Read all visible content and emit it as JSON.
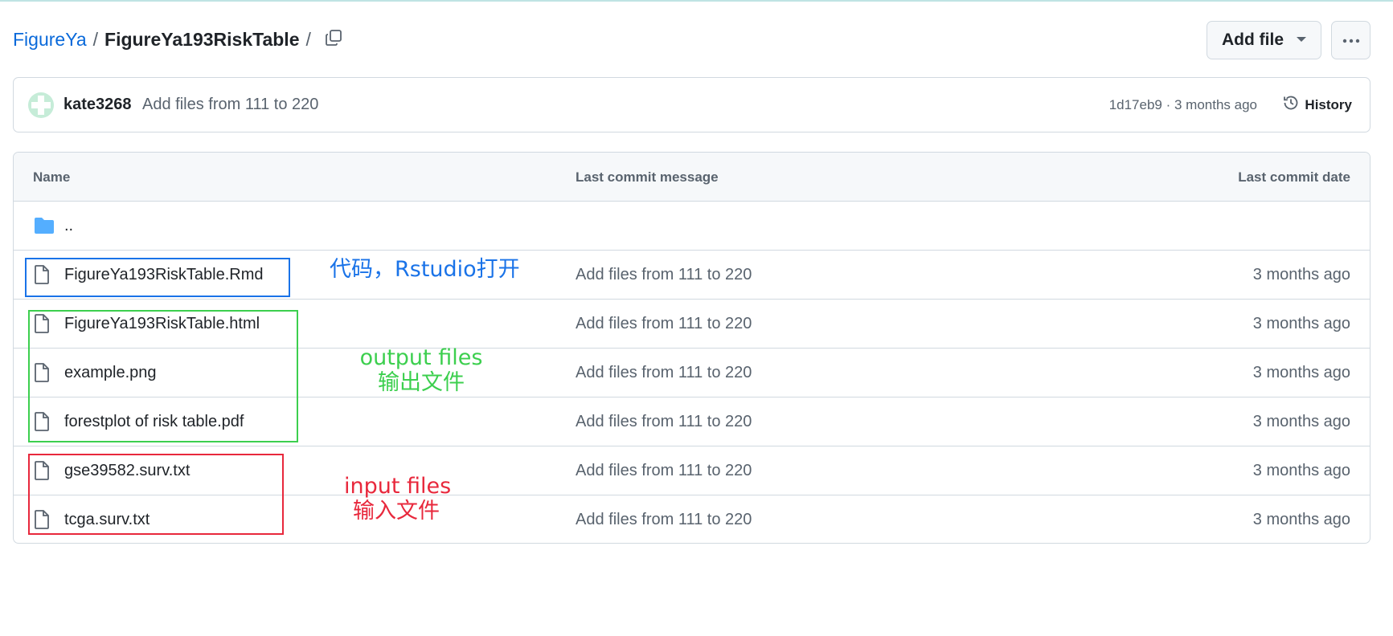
{
  "breadcrumb": {
    "repo": "FigureYa",
    "separator": "/",
    "folder": "FigureYa193RiskTable",
    "trailing_separator": "/"
  },
  "actions": {
    "add_file_label": "Add file"
  },
  "commit": {
    "author": "kate3268",
    "message": "Add files from 111 to 220",
    "meta": "1d17eb9 · 3 months ago",
    "history_label": "History"
  },
  "table": {
    "headers": {
      "name": "Name",
      "message": "Last commit message",
      "date": "Last commit date"
    },
    "parent_dir": "..",
    "files": [
      {
        "name": "FigureYa193RiskTable.Rmd",
        "message": "Add files from 111 to 220",
        "date": "3 months ago"
      },
      {
        "name": "FigureYa193RiskTable.html",
        "message": "Add files from 111 to 220",
        "date": "3 months ago"
      },
      {
        "name": "example.png",
        "message": "Add files from 111 to 220",
        "date": "3 months ago"
      },
      {
        "name": "forestplot of risk table.pdf",
        "message": "Add files from 111 to 220",
        "date": "3 months ago"
      },
      {
        "name": "gse39582.surv.txt",
        "message": "Add files from 111 to 220",
        "date": "3 months ago"
      },
      {
        "name": "tcga.surv.txt",
        "message": "Add files from 111 to 220",
        "date": "3 months ago"
      }
    ]
  },
  "annotations": {
    "code": "代码，Rstudio打开",
    "output_en": "output files",
    "output_zh": "输出文件",
    "input_en": "input files",
    "input_zh": "输入文件"
  },
  "colors": {
    "link": "#0969da",
    "folder": "#54aeff",
    "annotation_blue": "#1a73e8",
    "annotation_green": "#3ccf4e",
    "annotation_red": "#e8283c"
  },
  "icons": {
    "copy": "copy-icon",
    "more": "kebab-horizontal-icon",
    "history": "history-icon",
    "folder": "folder-icon",
    "file": "file-icon"
  }
}
